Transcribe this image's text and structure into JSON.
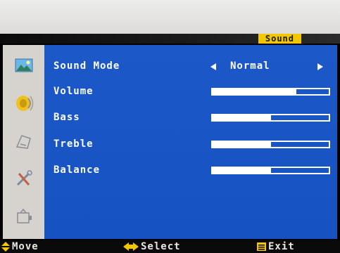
{
  "osd": {
    "title": "Sound",
    "accent_color": "#f2c600",
    "panel_color": "#1c58c8",
    "sidebar_icons": [
      "picture-icon",
      "sound-icon",
      "settings-icon",
      "tools-icon",
      "input-source-icon"
    ],
    "items": [
      {
        "label": "Sound Mode",
        "type": "selector",
        "value": "Normal"
      },
      {
        "label": "Volume",
        "type": "slider",
        "level": 0.72
      },
      {
        "label": "Bass",
        "type": "slider",
        "level": 0.5
      },
      {
        "label": "Treble",
        "type": "slider",
        "level": 0.5
      },
      {
        "label": "Balance",
        "type": "slider",
        "level": 0.5
      }
    ],
    "footer": {
      "move": "Move",
      "select": "Select",
      "exit": "Exit"
    }
  }
}
